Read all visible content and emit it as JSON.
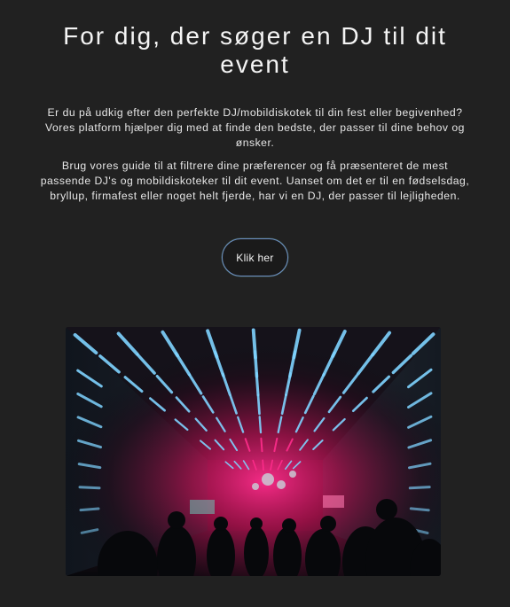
{
  "hero": {
    "heading_line1": "For dig, der søger en DJ til dit",
    "heading_line2": "event",
    "paragraph1": [
      "Er du på udkig efter den perfekte DJ/mobildiskotek til din fest eller begivenhed?",
      "Vores platform hjælper dig med at finde den bedste, der passer til dine behov og",
      "ønsker."
    ],
    "paragraph2": [
      "Brug vores guide til at filtrere dine præferencer og få præsenteret de mest",
      "passende DJ's og mobildiskoteker til dit event. Uanset om det er til en fødselsdag,",
      "bryllup, firmafest eller noget helt fjerde, har vi en DJ, der passer til lejligheden."
    ],
    "cta_label": "Klik her"
  },
  "colors": {
    "background": "#212121",
    "text": "#ececec",
    "button_border": "#6d8fc4",
    "light_blue": "#7fd3ff",
    "light_pink": "#ff2d8c"
  }
}
